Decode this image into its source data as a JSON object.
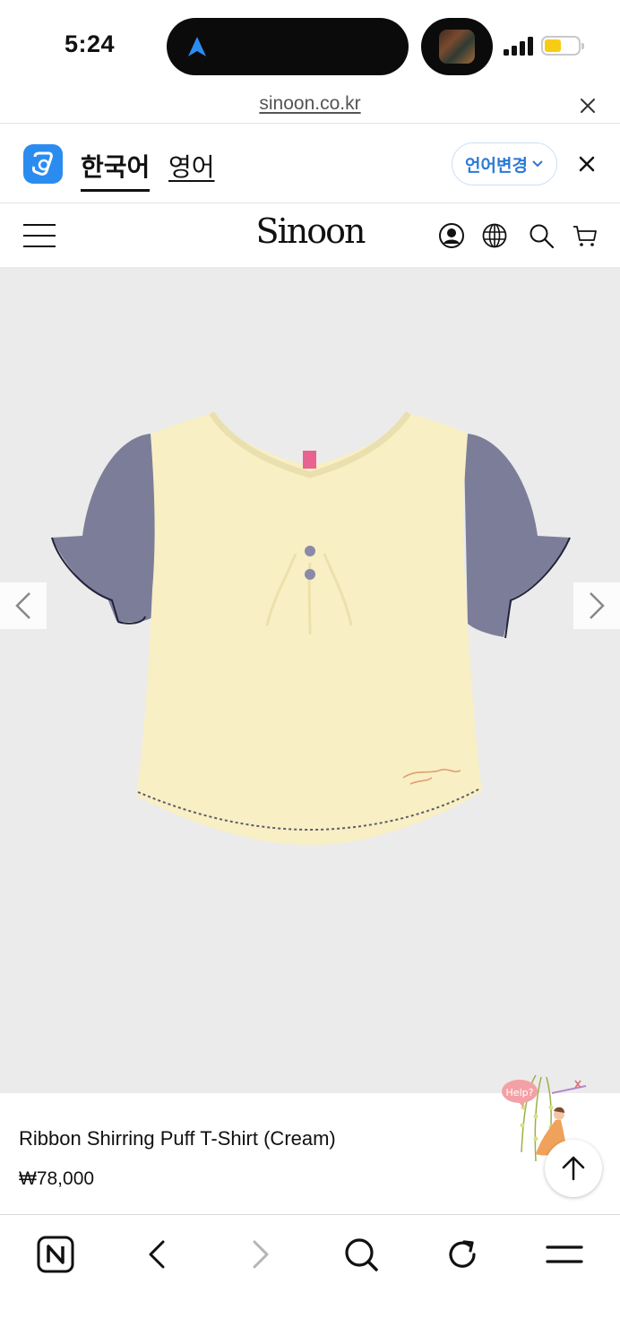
{
  "status_bar": {
    "time": "5:24",
    "battery_level": 0.35,
    "battery_color": "#f7cc14",
    "navigation_indicator_color": "#2b8cf0"
  },
  "url_bar": {
    "domain": "sinoon.co.kr",
    "close_icon": "close-icon"
  },
  "translate_bar": {
    "active_language": "한국어",
    "other_language": "영어",
    "change_language_label": "언어변경",
    "accent_color": "#2b7ad6"
  },
  "header": {
    "brand": "Sinoon",
    "icons": [
      "hamburger-menu-icon",
      "account-icon",
      "globe-icon",
      "search-icon",
      "cart-icon"
    ]
  },
  "product": {
    "name": "Ribbon Shirring Puff T-Shirt (Cream)",
    "price": "₩78,000",
    "image_background": "#ebebeb",
    "help_label": "Help?"
  },
  "browser_toolbar": {
    "icons": [
      "naver-home-icon",
      "back-icon",
      "forward-icon",
      "search-icon",
      "reload-icon",
      "menu-icon"
    ]
  }
}
